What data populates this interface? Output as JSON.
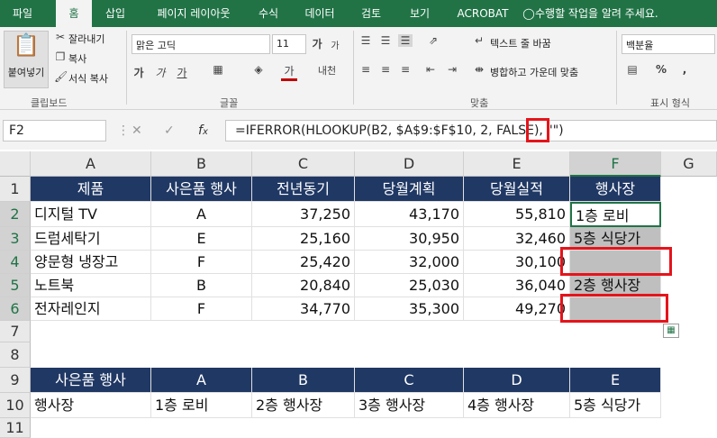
{
  "tabs": [
    "파일",
    "홈",
    "삽입",
    "페이지 레이아웃",
    "수식",
    "데이터",
    "검토",
    "보기",
    "ACROBAT"
  ],
  "tell_me": "수행할 작업을 알려 주세요.",
  "ribbon": {
    "paste": "붙여넣기",
    "cut": "잘라내기",
    "copy": "복사",
    "format_painter": "서식 복사",
    "font_name": "맑은 고딕",
    "font_size": "11",
    "wrap_text": "텍스트 줄 바꿈",
    "merge_center": "병합하고 가운데 맞춤",
    "number_format": "백분율",
    "groups": {
      "clipboard": "클립보드",
      "font": "글꼴",
      "alignment": "맞춤",
      "number": "표시 형식"
    }
  },
  "formula_bar": {
    "name_box": "F2",
    "formula": "=IFERROR(HLOOKUP(B2, $A$9:$F$10, 2, FALSE), \"\")"
  },
  "columns": [
    "A",
    "B",
    "C",
    "D",
    "E",
    "F",
    "G"
  ],
  "rows": [
    "1",
    "2",
    "3",
    "4",
    "5",
    "6",
    "7",
    "8",
    "9",
    "10",
    "11"
  ],
  "table1": {
    "headers": [
      "제품",
      "사은품 행사",
      "전년동기",
      "당월계획",
      "당월실적",
      "행사장"
    ],
    "rows": [
      [
        "디지털 TV",
        "A",
        "37,250",
        "43,170",
        "55,810",
        "1층 로비"
      ],
      [
        "드럼세탁기",
        "E",
        "25,160",
        "30,950",
        "32,460",
        "5층 식당가"
      ],
      [
        "양문형 냉장고",
        "F",
        "25,420",
        "32,000",
        "30,100",
        ""
      ],
      [
        "노트북",
        "B",
        "20,840",
        "25,030",
        "36,040",
        "2층 행사장"
      ],
      [
        "전자레인지",
        "F",
        "34,770",
        "35,300",
        "49,270",
        ""
      ]
    ]
  },
  "table2": {
    "header": [
      "사은품 행사",
      "A",
      "B",
      "C",
      "D",
      "E"
    ],
    "values": [
      "행사장",
      "1층 로비",
      "2층 행사장",
      "3층 행사장",
      "4층 행사장",
      "5층 식당가"
    ]
  },
  "colors": {
    "excel_green": "#217346",
    "header_navy": "#203864",
    "highlight_red": "#e5141b",
    "empty_gray": "#bfbfbf"
  }
}
